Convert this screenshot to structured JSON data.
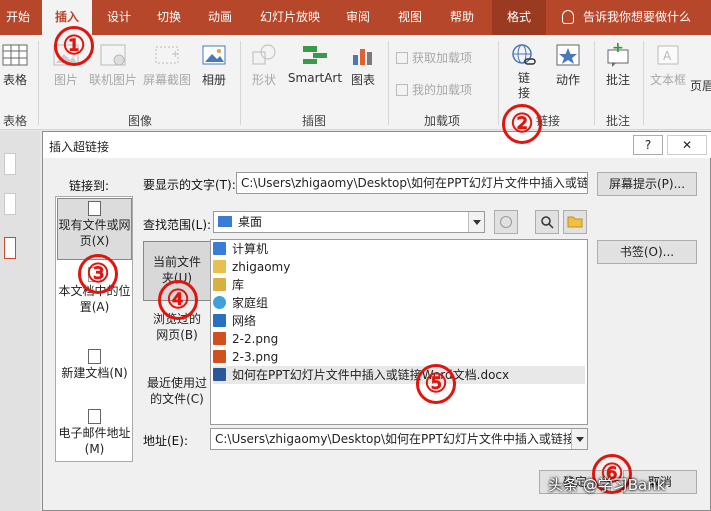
{
  "ribbon": {
    "tabs": [
      {
        "label": "开始",
        "active": false
      },
      {
        "label": "插入",
        "active": true
      },
      {
        "label": "设计",
        "active": false
      },
      {
        "label": "切换",
        "active": false
      },
      {
        "label": "动画",
        "active": false
      },
      {
        "label": "幻灯片放映",
        "active": false
      },
      {
        "label": "审阅",
        "active": false
      },
      {
        "label": "视图",
        "active": false
      },
      {
        "label": "帮助",
        "active": false
      },
      {
        "label": "格式",
        "active": false
      }
    ],
    "tell_me": "告诉我你想要做什么",
    "buttons": {
      "table": "表格",
      "pictures": "图片",
      "online_pictures": "联机图片",
      "screenshot": "屏幕截图",
      "album": "相册",
      "shapes": "形状",
      "smartart": "SmartArt",
      "chart": "图表",
      "get_addins": "获取加载项",
      "my_addins": "我的加载项",
      "link": "链接",
      "action": "动作",
      "comment": "批注",
      "textbox": "文本框",
      "header": "页眉"
    },
    "groups": {
      "tables": "表格",
      "images": "图像",
      "illustrations": "插图",
      "addins": "加载项",
      "links": "链接",
      "comments": "批注"
    }
  },
  "dialog": {
    "title": "插入超链接",
    "help_symbol": "?",
    "close_symbol": "✕",
    "link_to_label": "链接到:",
    "display_text_label": "要显示的文字(T):",
    "display_text_value": "C:\\Users\\zhigaomy\\Desktop\\如何在PPT幻灯片文件中插入或链接Word文档.docx",
    "screentip_button": "屏幕提示(P)...",
    "look_in_label": "查找范围(L):",
    "look_in_value": "桌面",
    "bookmark_button": "书签(O)...",
    "link_options": [
      {
        "label": "现有文件或网页(X)",
        "selected": true
      },
      {
        "label": "本文档中的位置(A)",
        "selected": false
      },
      {
        "label": "新建文档(N)",
        "selected": false
      },
      {
        "label": "电子邮件地址(M)",
        "selected": false
      }
    ],
    "look_options": [
      {
        "label": "当前文件夹(U)",
        "selected": true
      },
      {
        "label": "浏览过的网页(B)",
        "selected": false
      },
      {
        "label": "最近使用过的文件(C)",
        "selected": false
      }
    ],
    "files": [
      {
        "name": "计算机",
        "icon": "computer-icon"
      },
      {
        "name": "zhigaomy",
        "icon": "user-folder-icon"
      },
      {
        "name": "库",
        "icon": "library-icon"
      },
      {
        "name": "家庭组",
        "icon": "homegroup-icon"
      },
      {
        "name": "网络",
        "icon": "network-icon"
      },
      {
        "name": "2-2.png",
        "icon": "image-file-icon"
      },
      {
        "name": "2-3.png",
        "icon": "image-file-icon"
      },
      {
        "name": "如何在PPT幻灯片文件中插入或链接Word文档.docx",
        "icon": "word-file-icon"
      }
    ],
    "address_label": "地址(E):",
    "address_value": "C:\\Users\\zhigaomy\\Desktop\\如何在PPT幻灯片文件中插入或链接Word文档.docx",
    "ok_button": "确定",
    "cancel_button": "取消"
  },
  "annotations": [
    "①",
    "②",
    "③",
    "④",
    "⑤",
    "⑥"
  ],
  "watermark": "头条 @学习Bank",
  "colors": {
    "accent": "#b7472a",
    "annotation": "#e0160e"
  }
}
